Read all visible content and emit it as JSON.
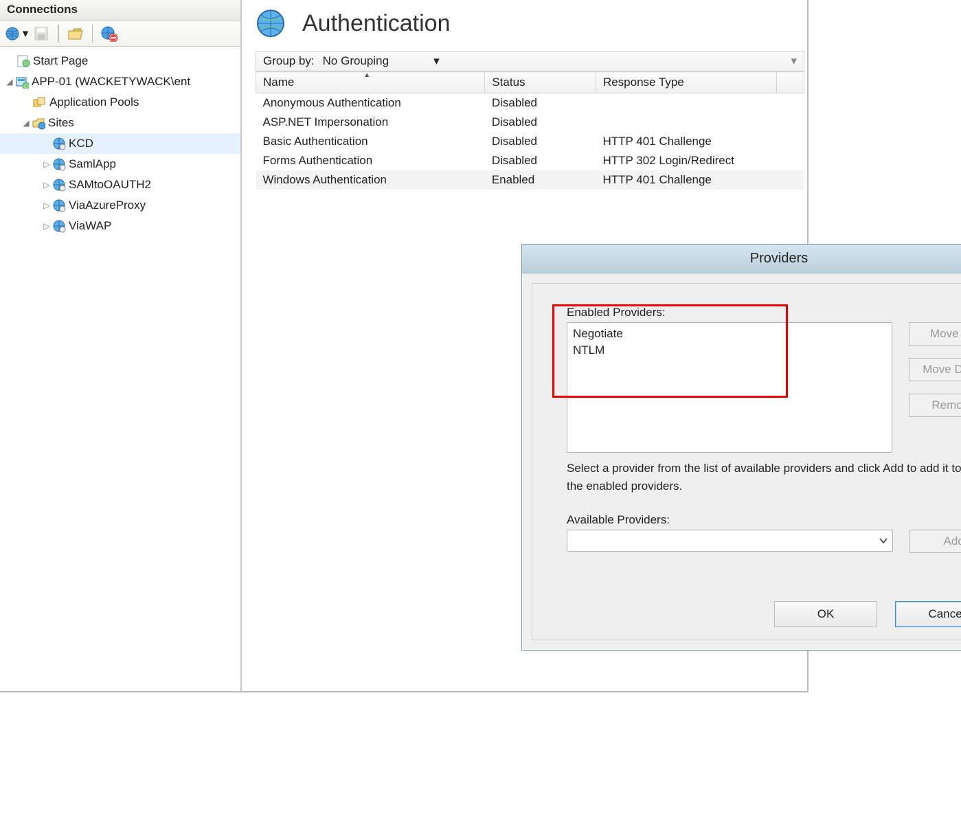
{
  "sidebar": {
    "title": "Connections",
    "tree": {
      "start": "Start Page",
      "server": "APP-01 (WACKETYWACK\\ent",
      "app_pools": "Application Pools",
      "sites_label": "Sites",
      "sites": [
        {
          "label": "KCD",
          "selected": true,
          "expandable": false
        },
        {
          "label": "SamlApp",
          "selected": false,
          "expandable": true
        },
        {
          "label": "SAMtoOAUTH2",
          "selected": false,
          "expandable": true
        },
        {
          "label": "ViaAzureProxy",
          "selected": false,
          "expandable": true
        },
        {
          "label": "ViaWAP",
          "selected": false,
          "expandable": true
        }
      ]
    }
  },
  "main": {
    "title": "Authentication",
    "group_label": "Group by:",
    "group_value": "No Grouping",
    "columns": {
      "name": "Name",
      "status": "Status",
      "rtype": "Response Type"
    },
    "rows": [
      {
        "name": "Anonymous Authentication",
        "status": "Disabled",
        "rtype": ""
      },
      {
        "name": "ASP.NET Impersonation",
        "status": "Disabled",
        "rtype": ""
      },
      {
        "name": "Basic Authentication",
        "status": "Disabled",
        "rtype": "HTTP 401 Challenge"
      },
      {
        "name": "Forms Authentication",
        "status": "Disabled",
        "rtype": "HTTP 302 Login/Redirect"
      },
      {
        "name": "Windows Authentication",
        "status": "Enabled",
        "rtype": "HTTP 401 Challenge"
      }
    ]
  },
  "dialog": {
    "title": "Providers",
    "help": "?",
    "close": "x",
    "enabled_label": "Enabled Providers:",
    "enabled_items": [
      "Negotiate",
      "NTLM"
    ],
    "move_up": "Move Up",
    "move_down": "Move Down",
    "remove": "Remove",
    "hint": "Select a provider from the list of available providers and click Add to add it to the enabled providers.",
    "available_label": "Available Providers:",
    "add": "Add",
    "ok": "OK",
    "cancel": "Cancel"
  }
}
